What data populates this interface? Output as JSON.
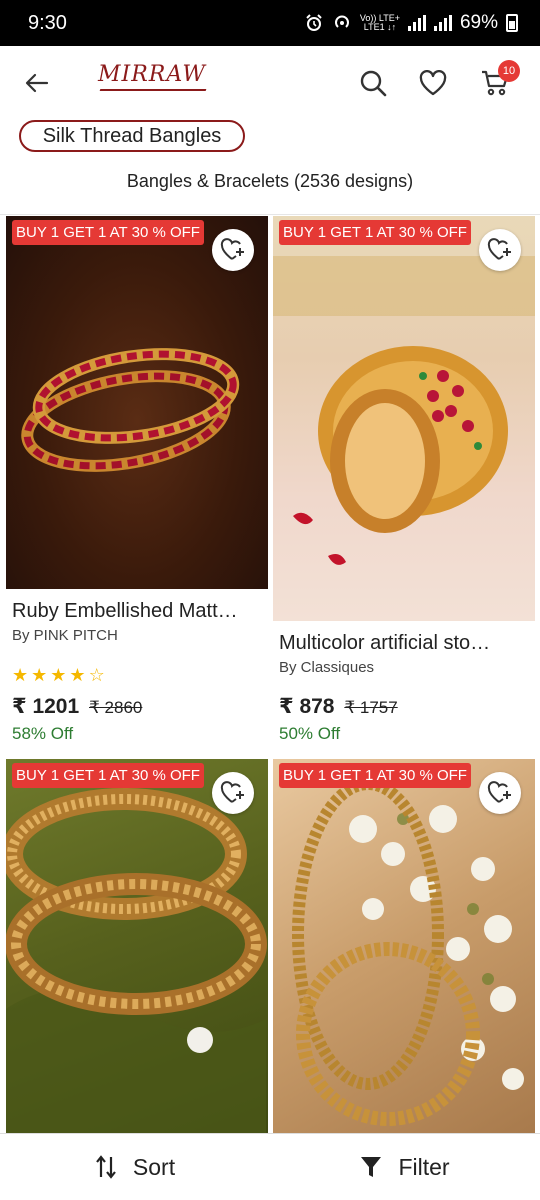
{
  "status_bar": {
    "time": "9:30",
    "network": "Vo)) LTE+",
    "network2": "LTE1 ↓↑",
    "battery": "69%"
  },
  "header": {
    "logo": "MIRRAW",
    "cart_count": "10",
    "icons": [
      "back-arrow-icon",
      "search-icon",
      "heart-icon",
      "cart-icon"
    ]
  },
  "search": {
    "chip_label": "Silk Thread Bangles",
    "results_title": "Bangles & Bracelets (2536 designs)"
  },
  "products": [
    {
      "offer": "BUY 1 GET 1 AT 30 % OFF",
      "name": "Ruby Embellished Matt…",
      "brand": "By PINK PITCH",
      "rating": 4,
      "stars_max": 5,
      "price": "₹ 1201",
      "old_price": "₹ 2860",
      "discount": "58% Off"
    },
    {
      "offer": "BUY 1 GET 1 AT 30 % OFF",
      "name": "Multicolor artificial sto…",
      "brand": "By Classiques",
      "price": "₹ 878",
      "old_price": "₹ 1757",
      "discount": "50% Off"
    },
    {
      "offer": "BUY 1 GET 1 AT 30 % OFF"
    },
    {
      "offer": "BUY 1 GET 1 AT 30 % OFF"
    }
  ],
  "bottom_bar": {
    "sort_label": "Sort",
    "filter_label": "Filter"
  },
  "colors": {
    "brand": "#8b1a1a",
    "offer_badge": "#e53935",
    "discount_green": "#2e7d32",
    "star": "#f5b800"
  }
}
